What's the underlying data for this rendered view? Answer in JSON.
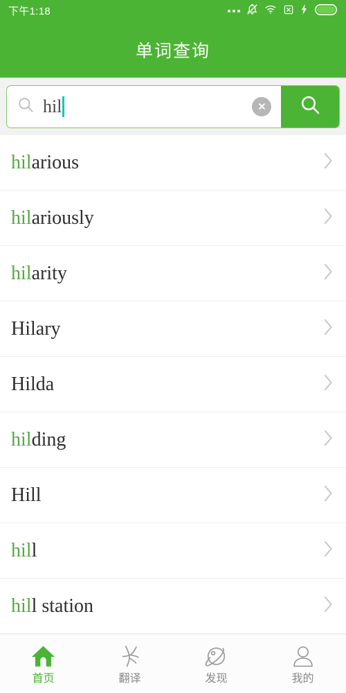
{
  "status_bar": {
    "time": "下午1:18",
    "icons": [
      "more-dots-icon",
      "bell-muted-icon",
      "wifi-icon",
      "sim-x-icon",
      "charging-bolt-icon",
      "battery-icon"
    ]
  },
  "header": {
    "title": "单词查询"
  },
  "search": {
    "value": "hil",
    "placeholder": "",
    "search_icon": "search-icon",
    "clear_icon": "clear-circle-icon",
    "submit_icon": "search-icon",
    "caret_color": "#17C8B4",
    "border_color": "#7DC963",
    "button_color": "#4CB434"
  },
  "suggestions": {
    "highlight_color": "#56A843",
    "text_color": "#2E2E2E",
    "chevron_icon": "chevron-right-icon",
    "items": [
      {
        "highlight": "hil",
        "rest": "arious",
        "full": "hilarious"
      },
      {
        "highlight": "hil",
        "rest": "ariously",
        "full": "hilariously"
      },
      {
        "highlight": "hil",
        "rest": "arity",
        "full": "hilarity"
      },
      {
        "highlight": "",
        "rest": "Hilary",
        "full": "Hilary"
      },
      {
        "highlight": "",
        "rest": "Hilda",
        "full": "Hilda"
      },
      {
        "highlight": "hil",
        "rest": "ding",
        "full": "hilding"
      },
      {
        "highlight": "",
        "rest": "Hill",
        "full": "Hill"
      },
      {
        "highlight": "hil",
        "rest": "l",
        "full": "hill"
      },
      {
        "highlight": "hil",
        "rest": "l station",
        "full": "hill station"
      }
    ]
  },
  "tabbar": {
    "active_color": "#4CB434",
    "inactive_color": "#8A8A8A",
    "items": [
      {
        "label": "首页",
        "icon": "home-icon",
        "active": true
      },
      {
        "label": "翻译",
        "icon": "translate-icon",
        "active": false
      },
      {
        "label": "发现",
        "icon": "planet-icon",
        "active": false
      },
      {
        "label": "我的",
        "icon": "person-icon",
        "active": false
      }
    ]
  },
  "theme": {
    "brand_green": "#4CB434",
    "search_bg": "#F2F2F2",
    "divider": "#EFEFEF"
  }
}
